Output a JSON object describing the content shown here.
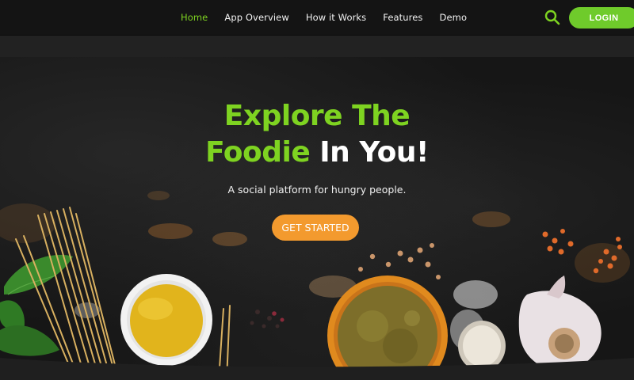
{
  "nav": {
    "items": [
      {
        "label": "Home",
        "active": true
      },
      {
        "label": "App Overview",
        "active": false
      },
      {
        "label": "How it Works",
        "active": false
      },
      {
        "label": "Features",
        "active": false
      },
      {
        "label": "Demo",
        "active": false
      }
    ],
    "search_icon": "search-icon",
    "login_label": "LOGIN"
  },
  "hero": {
    "title_line1": "Explore The",
    "title_line2_green": "Foodie",
    "title_line2_white": "In You!",
    "subtitle": "A social platform for hungry people.",
    "cta_label": "GET STARTED"
  },
  "colors": {
    "accent_green": "#7ed321",
    "login_green": "#6fcb2b",
    "cta_orange": "#f39a2e",
    "background": "#161616"
  }
}
